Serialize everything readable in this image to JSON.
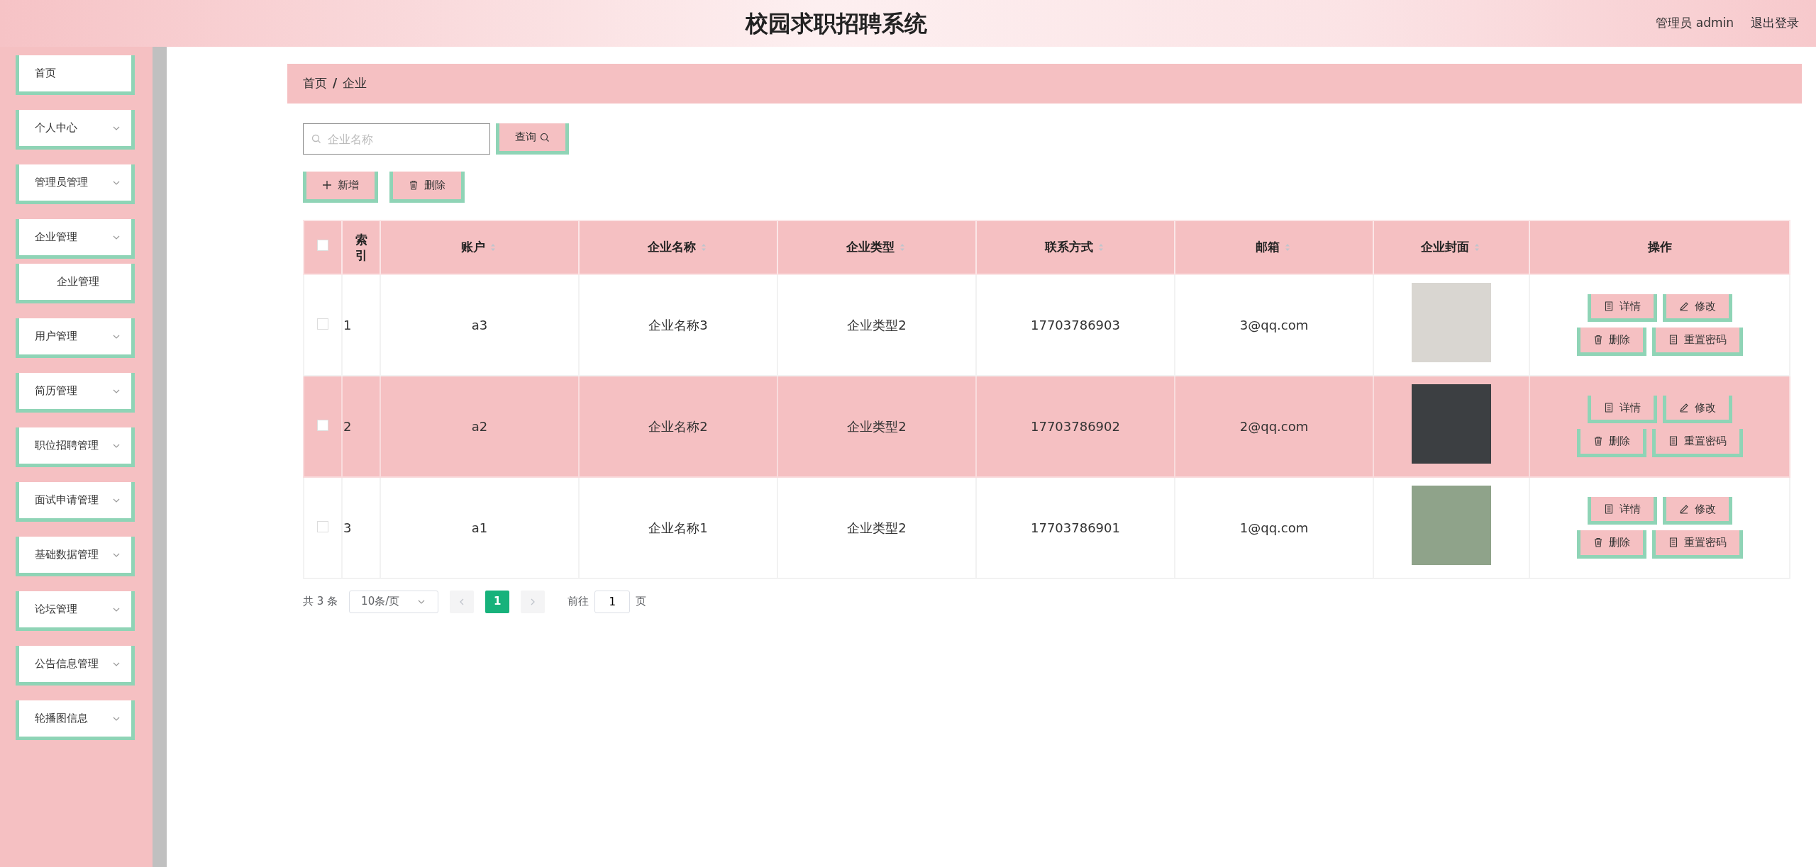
{
  "header": {
    "title": "校园求职招聘系统",
    "user": "管理员 admin",
    "logout": "退出登录"
  },
  "sidebar": {
    "items": [
      {
        "label": "首页",
        "kind": "link"
      },
      {
        "label": "个人中心",
        "kind": "menu"
      },
      {
        "label": "管理员管理",
        "kind": "menu"
      },
      {
        "label": "企业管理",
        "kind": "menu",
        "children": [
          {
            "label": "企业管理"
          }
        ]
      },
      {
        "label": "用户管理",
        "kind": "menu"
      },
      {
        "label": "简历管理",
        "kind": "menu"
      },
      {
        "label": "职位招聘管理",
        "kind": "menu"
      },
      {
        "label": "面试申请管理",
        "kind": "menu"
      },
      {
        "label": "基础数据管理",
        "kind": "menu"
      },
      {
        "label": "论坛管理",
        "kind": "menu"
      },
      {
        "label": "公告信息管理",
        "kind": "menu"
      },
      {
        "label": "轮播图信息",
        "kind": "menu"
      }
    ]
  },
  "breadcrumb": {
    "items": [
      "首页",
      "企业"
    ],
    "separator": "/"
  },
  "search": {
    "placeholder": "企业名称",
    "button": "查询"
  },
  "actions": [
    "新增",
    "删除"
  ],
  "table": {
    "select_all_checked": false,
    "columns": [
      {
        "label": "索引",
        "sortable": false
      },
      {
        "label": "账户",
        "sortable": true
      },
      {
        "label": "企业名称",
        "sortable": true
      },
      {
        "label": "企业类型",
        "sortable": true
      },
      {
        "label": "联系方式",
        "sortable": true
      },
      {
        "label": "邮箱",
        "sortable": true
      },
      {
        "label": "企业封面",
        "sortable": true
      },
      {
        "label": "操作",
        "sortable": false
      }
    ],
    "rows": [
      {
        "checked": false,
        "highlighted": false,
        "index": "1",
        "account": "a3",
        "name": "企业名称3",
        "type": "企业类型2",
        "phone": "17703786903",
        "email": "3@qq.com",
        "buttons": [
          "详情",
          "修改",
          "删除",
          "重置密码"
        ]
      },
      {
        "checked": false,
        "highlighted": true,
        "index": "2",
        "account": "a2",
        "name": "企业名称2",
        "type": "企业类型2",
        "phone": "17703786902",
        "email": "2@qq.com",
        "buttons": [
          "详情",
          "修改",
          "删除",
          "重置密码"
        ]
      },
      {
        "checked": false,
        "highlighted": false,
        "index": "3",
        "account": "a1",
        "name": "企业名称1",
        "type": "企业类型2",
        "phone": "17703786901",
        "email": "1@qq.com",
        "buttons": [
          "详情",
          "修改",
          "删除",
          "重置密码"
        ]
      }
    ]
  },
  "pagination": {
    "total": "共 3 条",
    "page_size": "10条/页",
    "pages": [
      {
        "label": "1",
        "selected": true
      }
    ],
    "goto_label": "前往",
    "goto_value": "1",
    "goto_suffix": "页"
  }
}
